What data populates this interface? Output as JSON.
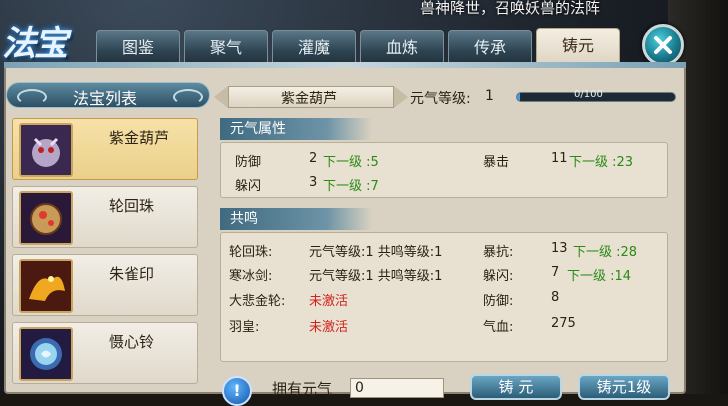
{
  "banner_text": "兽神降世，召唤妖兽的法阵",
  "logo_text": "法宝",
  "tabs": [
    {
      "label": "图鉴"
    },
    {
      "label": "聚气"
    },
    {
      "label": "灌魔"
    },
    {
      "label": "血炼"
    },
    {
      "label": "传承"
    },
    {
      "label": "铸元"
    }
  ],
  "active_tab": "铸元",
  "list": {
    "title": "法宝列表",
    "items": [
      {
        "name": "紫金葫芦",
        "icon": "gourd-creature-icon"
      },
      {
        "name": "轮回珠",
        "icon": "pearl-icon"
      },
      {
        "name": "朱雀印",
        "icon": "phoenix-icon"
      },
      {
        "name": "慑心铃",
        "icon": "bell-icon"
      }
    ]
  },
  "detail": {
    "item_name": "紫金葫芦",
    "level_label": "元气等级:",
    "level_value": "1",
    "progress_text": "0/100",
    "progress_fraction": 0.02
  },
  "attr_section": {
    "title": "元气属性",
    "rows": [
      {
        "name": "防御",
        "value": "2",
        "next": "下一级 :5"
      },
      {
        "name": "躲闪",
        "value": "3",
        "next": "下一级 :7"
      }
    ],
    "right": {
      "name": "暴击",
      "value": "11",
      "next": "下一级 :23"
    }
  },
  "resonance_section": {
    "title": "共鸣",
    "left_rows": [
      {
        "name": "轮回珠:",
        "value": "元气等级:1 共鸣等级:1",
        "status": "active"
      },
      {
        "name": "寒冰剑:",
        "value": "元气等级:1 共鸣等级:1",
        "status": "active"
      },
      {
        "name": "大悲金轮:",
        "value": "未激活",
        "status": "inactive"
      },
      {
        "name": "羽皇:",
        "value": "未激活",
        "status": "inactive"
      }
    ],
    "right_rows": [
      {
        "name": "暴抗:",
        "value": "13",
        "next": "下一级 :28"
      },
      {
        "name": "躲闪:",
        "value": "7",
        "next": "下一级 :14"
      },
      {
        "name": "防御:",
        "value": "8",
        "next": ""
      },
      {
        "name": "气血:",
        "value": "275",
        "next": ""
      }
    ]
  },
  "bottom": {
    "info_glyph": "!",
    "own_label": "拥有元气",
    "own_value": "0",
    "btn_forge": "铸 元",
    "btn_forge_one": "铸元1级"
  },
  "colors": {
    "green": "#2a8a18",
    "red": "#d2231e",
    "accent": "#3fa0e0"
  }
}
